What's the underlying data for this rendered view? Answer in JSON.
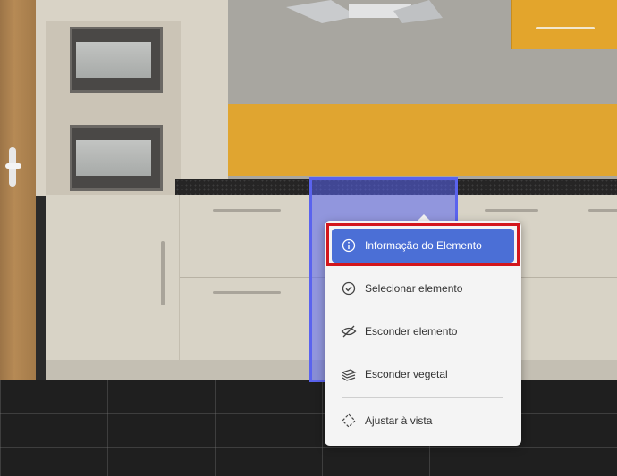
{
  "context_menu": {
    "items": [
      {
        "label": "Informação do Elemento",
        "icon": "info-icon",
        "active": true
      },
      {
        "label": "Selecionar elemento",
        "icon": "check-circle-icon",
        "active": false
      },
      {
        "label": "Esconder elemento",
        "icon": "eye-off-icon",
        "active": false
      },
      {
        "label": "Esconder vegetal",
        "icon": "layers-icon",
        "active": false
      },
      {
        "label": "Ajustar à vista",
        "icon": "fit-view-icon",
        "active": false
      }
    ]
  },
  "colors": {
    "accent": "#4b6fd6",
    "highlight_border": "#d3161c",
    "selection_fill": "#5864f0",
    "backsplash": "#e0a530"
  }
}
